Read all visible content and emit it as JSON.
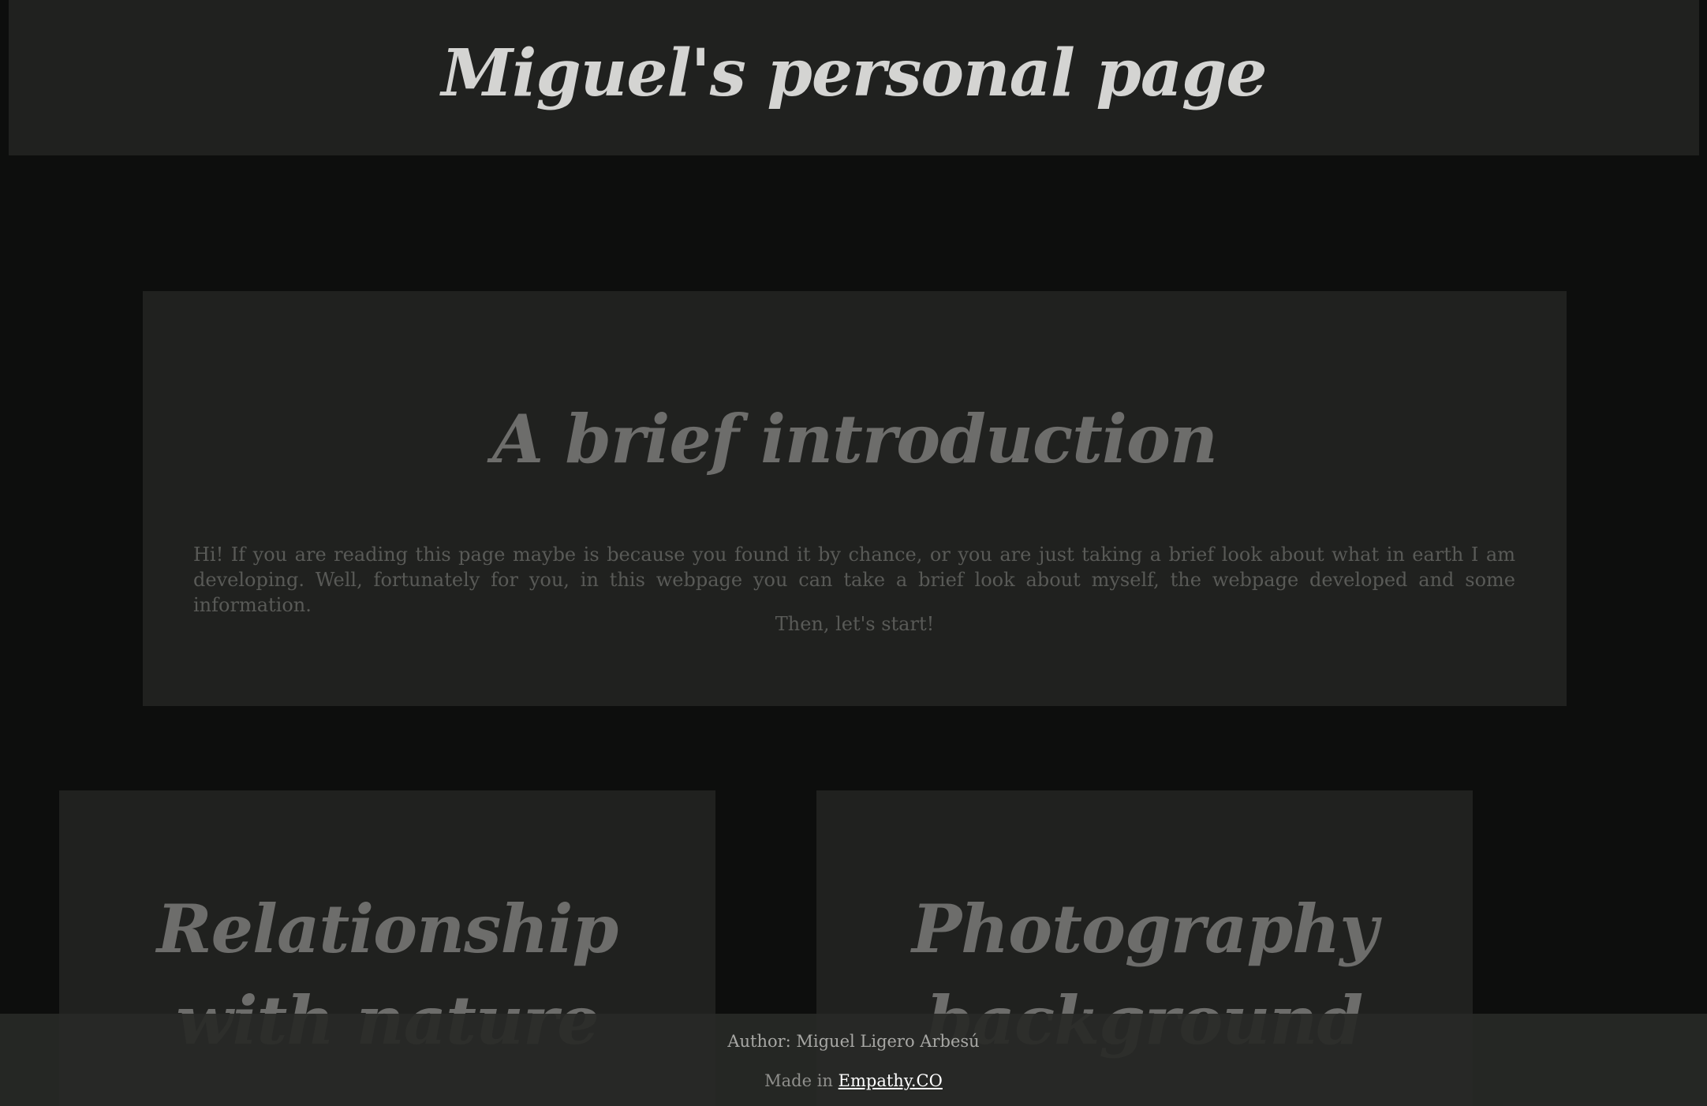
{
  "header": {
    "title": "Miguel's personal page"
  },
  "intro": {
    "heading": "A brief introduction",
    "paragraph": "Hi! If you are reading this page maybe is because you found it by chance, or you are just taking a brief look about what in earth I am developing. Well, fortunately for you, in this webpage you can take a brief look about myself, the webpage developed and some information.",
    "cta": "Then, let's start!"
  },
  "sections": [
    {
      "heading": "Relationship with nature"
    },
    {
      "heading": "Photography background"
    }
  ],
  "footer": {
    "author": "Author: Miguel Ligero Arbesú",
    "made_prefix": "Made in",
    "link_label": "Empathy.CO"
  },
  "colors": {
    "page_background": "#0d0e0d",
    "panel_background": "#20211f",
    "title_text": "#d4d4d2",
    "muted_heading": "#6d6d6b",
    "body_text": "#595a57",
    "footer_link": "#ffffff"
  }
}
